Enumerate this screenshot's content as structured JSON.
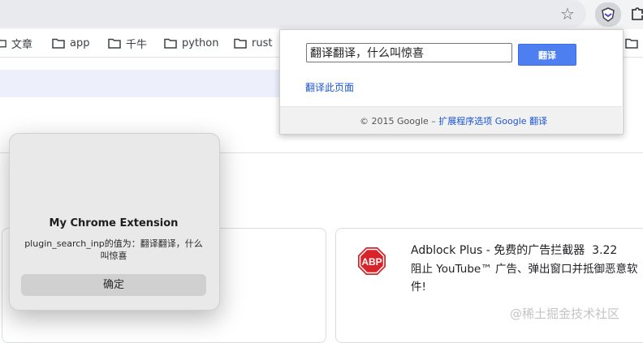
{
  "bookmarks": [
    {
      "label": "文章"
    },
    {
      "label": "app"
    },
    {
      "label": "千牛"
    },
    {
      "label": "python"
    },
    {
      "label": "rust"
    }
  ],
  "translate_popup": {
    "input_value": "翻译翻译，什么叫惊喜",
    "button_label": "翻译",
    "translate_page_link": "翻译此页面",
    "footer_copyright": "© 2015 Google –",
    "footer_options_link": "扩展程序选项",
    "footer_translate_link": "Google 翻译"
  },
  "extension_card": {
    "name": "Adblock Plus - 免费的广告拦截器",
    "version": "3.22",
    "description": "阻止 YouTube™ 广告、弹出窗口并抵御恶意软件!",
    "icon_text": "ABP"
  },
  "dialog": {
    "title": "My Chrome Extension",
    "message": "plugin_search_inp的值为：翻译翻译，什么叫惊喜",
    "ok_label": "确定"
  },
  "watermark": "@稀土掘金技术社区",
  "colors": {
    "accent_blue": "#4d7ff0",
    "link_blue": "#1a55d6",
    "abp_red": "#d8232a"
  }
}
